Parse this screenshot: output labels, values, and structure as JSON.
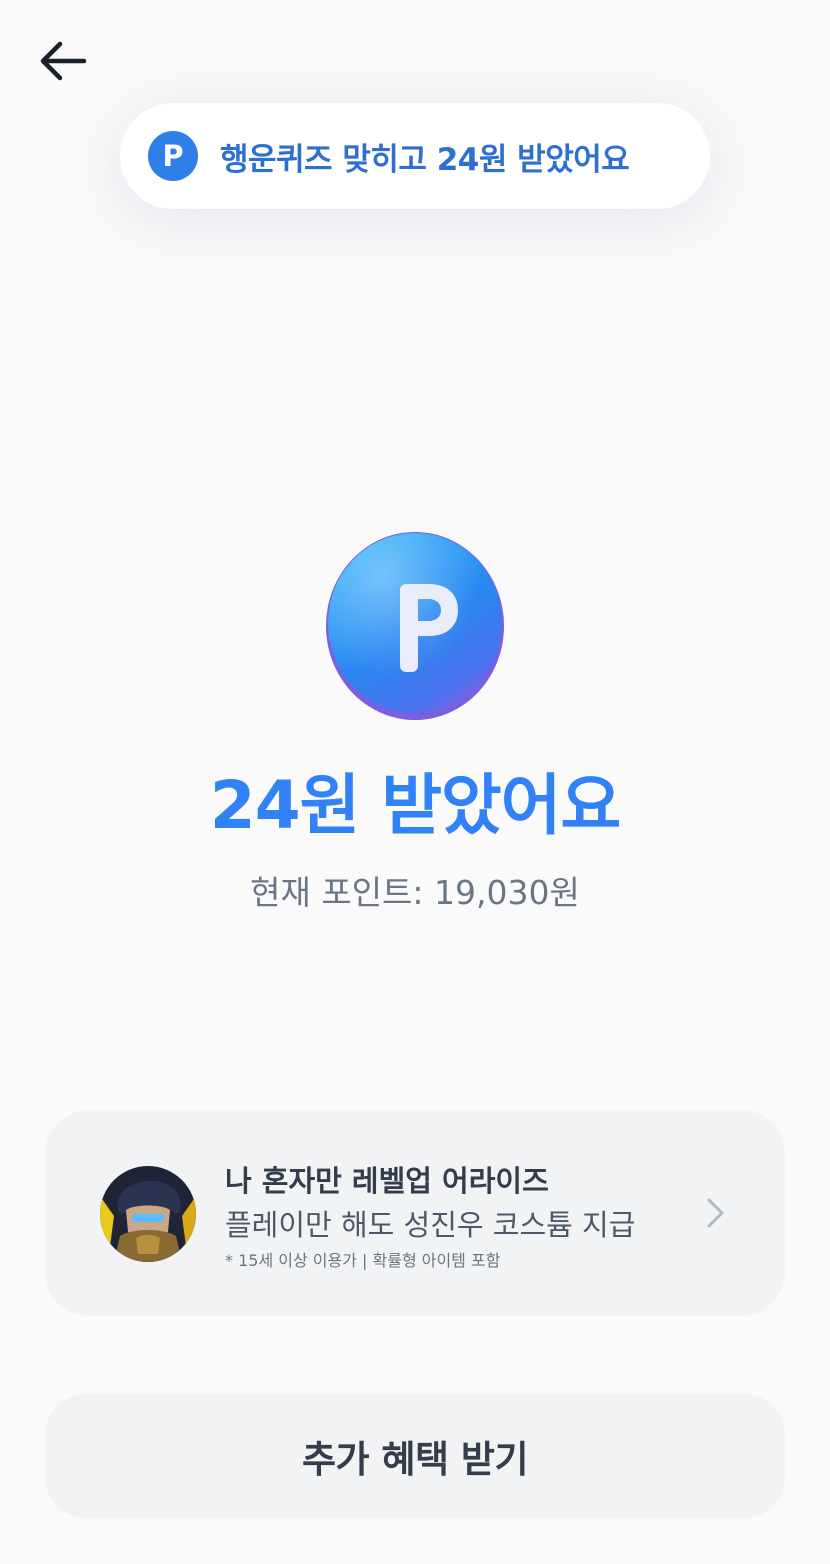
{
  "toast": {
    "icon_letter": "P",
    "message": "행운퀴즈 맞히고 24원 받았어요"
  },
  "reward": {
    "coin_letter": "P",
    "headline": "24원 받았어요",
    "points_text": "현재 포인트: 19,030원"
  },
  "promo": {
    "title": "나 혼자만 레벨업 어라이즈",
    "description": "플레이만 해도 성진우 코스튬 지급",
    "note": "* 15세 이상 이용가 | 확률형 아이템 포함"
  },
  "cta": {
    "label": "추가 혜택 받기"
  },
  "icons": {
    "back": "arrow-left-icon",
    "chevron": "chevron-right-icon",
    "point": "point-coin-icon"
  },
  "colors": {
    "accent": "#3182f6",
    "toast_text": "#2e6fcf",
    "card_bg": "#f2f3f5",
    "page_bg": "#fafafb"
  }
}
